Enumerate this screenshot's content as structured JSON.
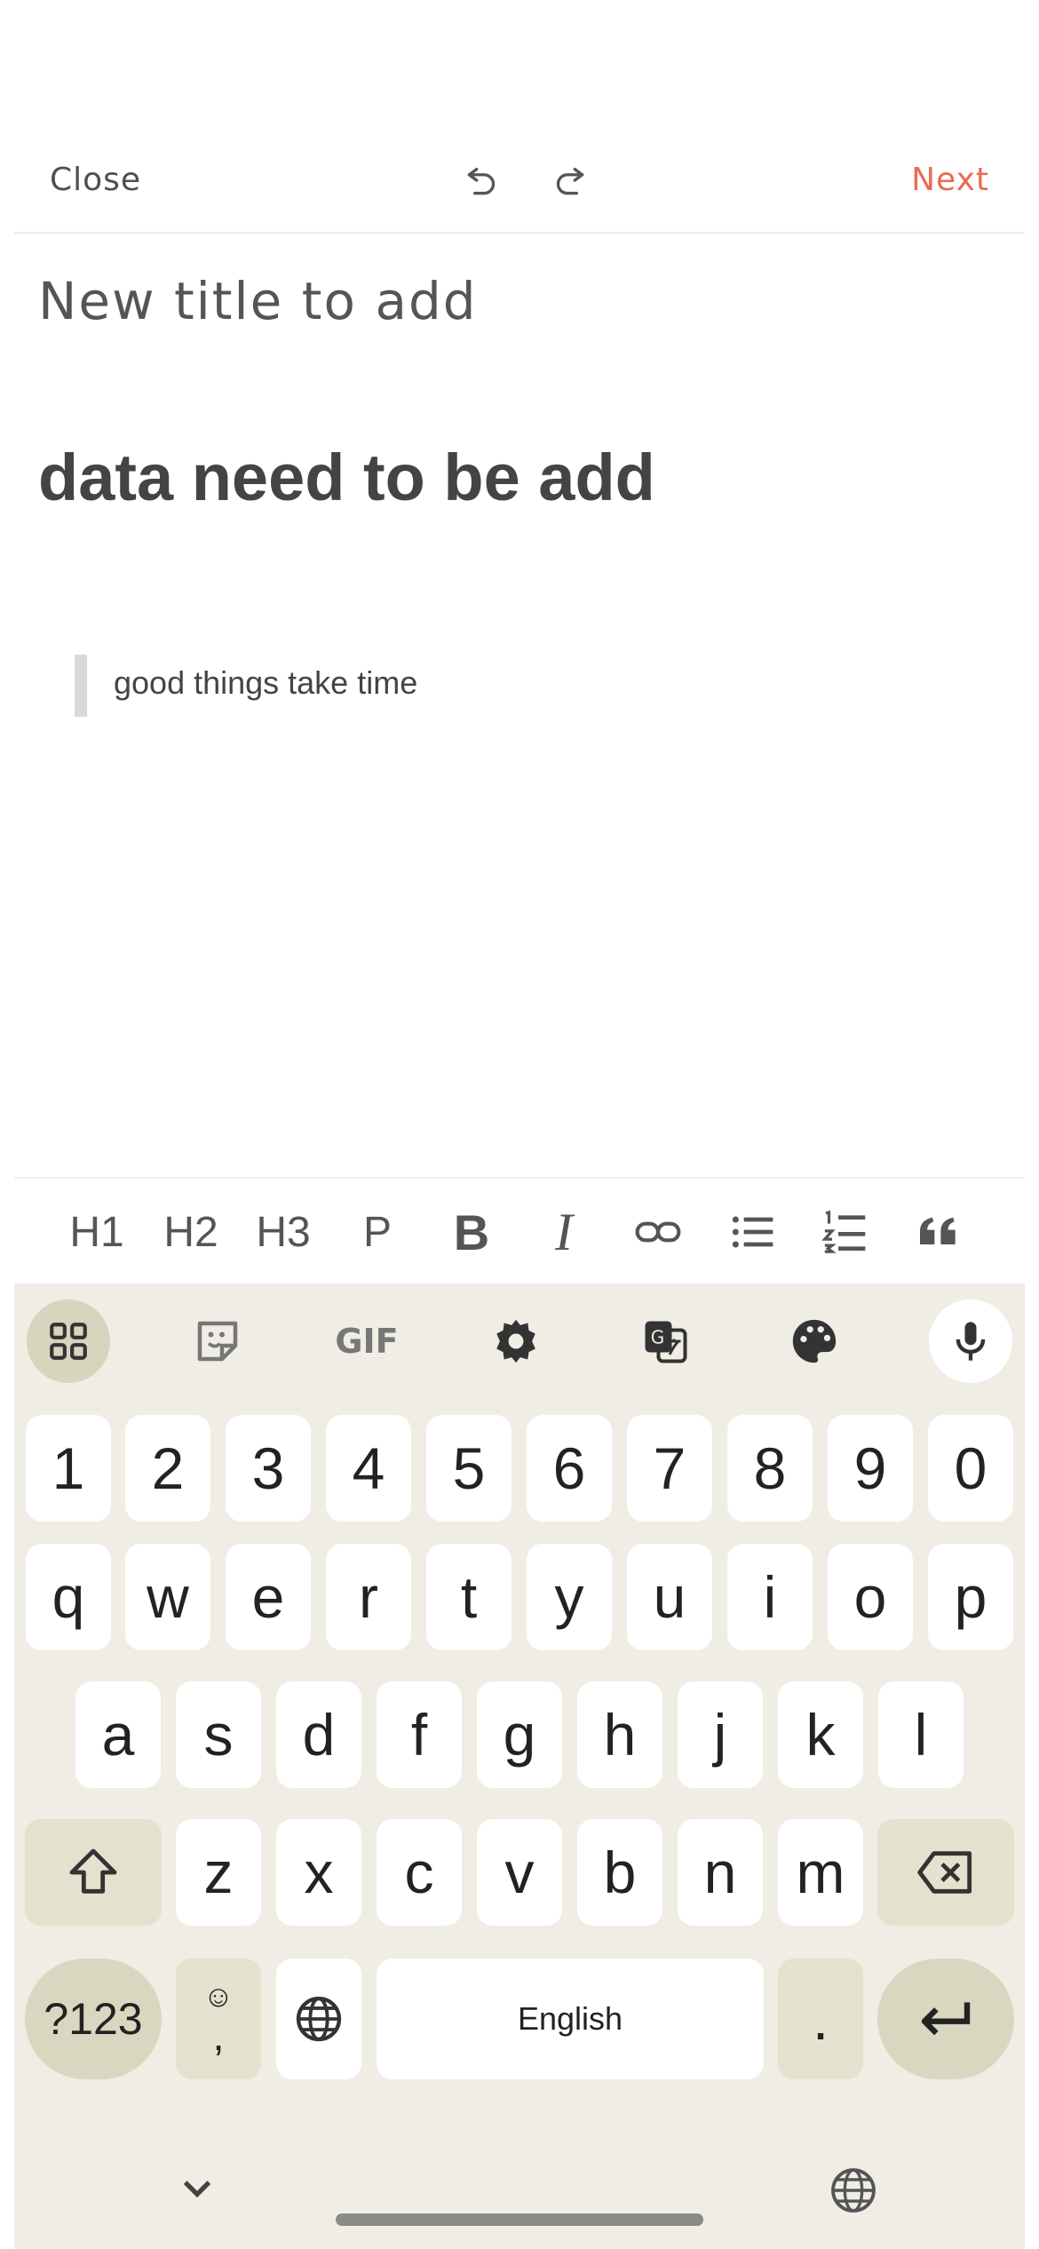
{
  "header": {
    "close_label": "Close",
    "next_label": "Next",
    "accent_color": "#ec6a52"
  },
  "editor": {
    "title": "New title to add",
    "heading": "data need to be add",
    "quote": "good things take time"
  },
  "format_toolbar": {
    "h1": "H1",
    "h2": "H2",
    "h3": "H3",
    "p": "P",
    "bold": "B",
    "italic": "I"
  },
  "keyboard": {
    "number_row": [
      "1",
      "2",
      "3",
      "4",
      "5",
      "6",
      "7",
      "8",
      "9",
      "0"
    ],
    "row_q": [
      "q",
      "w",
      "e",
      "r",
      "t",
      "y",
      "u",
      "i",
      "o",
      "p"
    ],
    "row_a": [
      "a",
      "s",
      "d",
      "f",
      "g",
      "h",
      "j",
      "k",
      "l"
    ],
    "row_z": [
      "z",
      "x",
      "c",
      "v",
      "b",
      "n",
      "m"
    ],
    "symbols_label": "?123",
    "comma_label": ",",
    "emoji_label": "☺",
    "space_label": "English",
    "period_label": "."
  },
  "icons": {
    "undo": "undo-icon",
    "redo": "redo-icon",
    "link": "link-icon",
    "bullet_list": "bullet-list-icon",
    "numbered_list": "numbered-list-icon",
    "quote": "quote-icon",
    "apps": "apps-grid-icon",
    "sticker": "sticker-icon",
    "gif": "gif-icon",
    "settings": "gear-icon",
    "translate": "translate-icon",
    "palette": "palette-icon",
    "mic": "mic-icon",
    "shift": "shift-icon",
    "backspace": "backspace-icon",
    "globe": "globe-icon",
    "enter": "enter-icon",
    "collapse": "chevron-down-icon"
  }
}
